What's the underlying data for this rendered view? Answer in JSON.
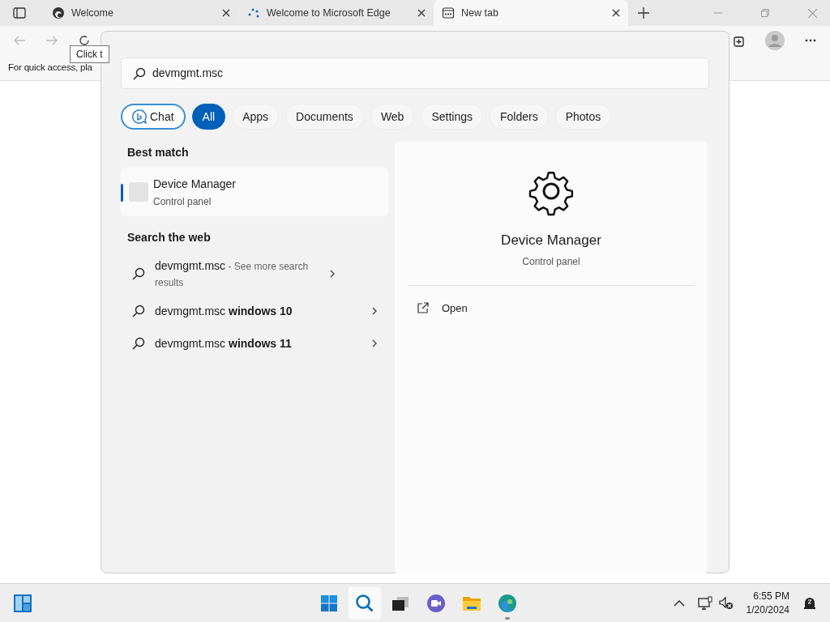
{
  "browser": {
    "tabs": [
      {
        "title": "Welcome",
        "kind": "edge",
        "selected": false
      },
      {
        "title": "Welcome to Microsoft Edge",
        "kind": "dots",
        "selected": false
      },
      {
        "title": "New tab",
        "kind": "newtab",
        "selected": true
      }
    ],
    "tooltip": "Click t",
    "favorites_hint": "For quick access, pla"
  },
  "search": {
    "query": "devmgmt.msc",
    "filters": [
      {
        "label": "Chat",
        "kind": "chat",
        "selected": false
      },
      {
        "label": "All",
        "kind": "text",
        "selected": true
      },
      {
        "label": "Apps",
        "kind": "text",
        "selected": false
      },
      {
        "label": "Documents",
        "kind": "text",
        "selected": false
      },
      {
        "label": "Web",
        "kind": "text",
        "selected": false
      },
      {
        "label": "Settings",
        "kind": "text",
        "selected": false
      },
      {
        "label": "Folders",
        "kind": "text",
        "selected": false
      },
      {
        "label": "Photos",
        "kind": "text",
        "selected": false
      }
    ],
    "best_match": {
      "heading": "Best match",
      "title": "Device Manager",
      "subtitle": "Control panel",
      "selected": true
    },
    "web": {
      "heading": "Search the web",
      "items": [
        {
          "text": "devmgmt.msc",
          "note": "- See more search results"
        },
        {
          "text": "devmgmt.msc **windows 10**"
        },
        {
          "text": "devmgmt.msc **windows 11**"
        }
      ]
    },
    "preview": {
      "title": "Device Manager",
      "subtitle": "Control panel",
      "actions": [
        {
          "label": "Open"
        }
      ]
    }
  },
  "taskbar": {
    "apps": [
      {
        "kind": "start",
        "selected": false,
        "running": false
      },
      {
        "kind": "search",
        "selected": true,
        "running": false
      },
      {
        "kind": "taskview",
        "selected": false,
        "running": false
      },
      {
        "kind": "chat",
        "selected": false,
        "running": false
      },
      {
        "kind": "files",
        "selected": false,
        "running": false
      },
      {
        "kind": "edge",
        "selected": false,
        "running": true
      }
    ],
    "time": "6:55 PM",
    "date": "1/20/2024"
  }
}
